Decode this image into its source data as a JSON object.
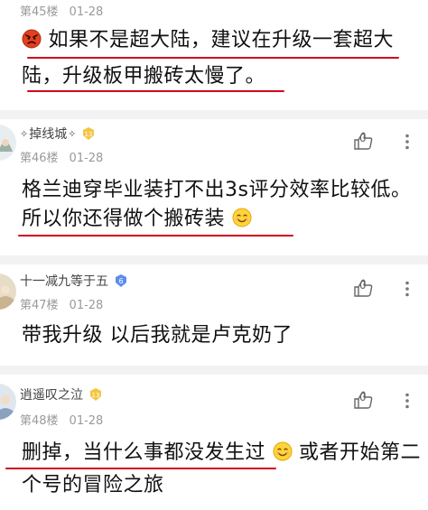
{
  "posts": [
    {
      "floor": "第45楼",
      "date": "01-28",
      "lines": [
        "如果不是超大陆，建议在升级一套超大",
        "陆，升级板甲搬砖太慢了。"
      ]
    },
    {
      "user_prefix": "✧",
      "username": "掉线城",
      "user_suffix": "✧",
      "level": "13",
      "floor": "第46楼",
      "date": "01-28",
      "like_count": "0",
      "lines": [
        "格兰迪穿毕业装打不出3s评分效率比较低。",
        "所以你还得做个搬砖装"
      ]
    },
    {
      "username": "十一减九等于五",
      "level": "6",
      "floor": "第47楼",
      "date": "01-28",
      "like_count": "0",
      "lines": [
        "带我升级 以后我就是卢克奶了"
      ]
    },
    {
      "username": "逍遥叹之泣",
      "level": "13",
      "floor": "第48楼",
      "date": "01-28",
      "like_count": "0",
      "lines": [
        "删掉，当什么事都没发生过",
        "或者开始第二",
        "个号的冒险之旅"
      ]
    }
  ],
  "colors": {
    "underline": "#d0021b",
    "badge_gold": "#f5c542",
    "badge_blue": "#5b8def"
  },
  "icons": {
    "like": "thumbs-up-icon",
    "more": "more-dots-icon",
    "emoji_angry": "angry-face-emoji",
    "emoji_smile": "smile-face-emoji"
  }
}
